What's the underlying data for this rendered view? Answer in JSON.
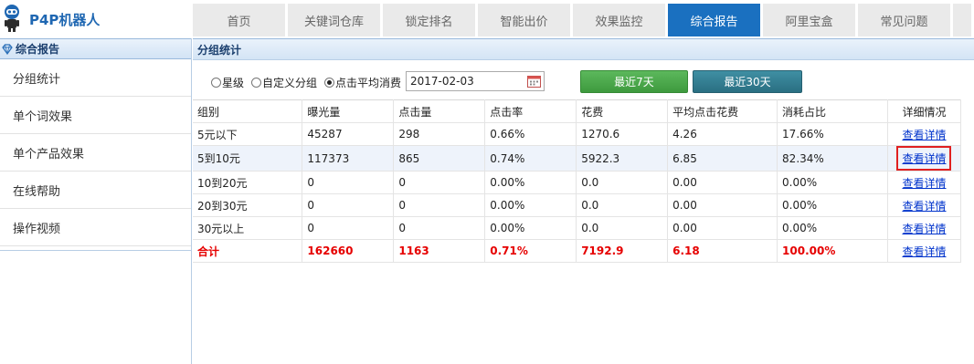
{
  "app": {
    "logo_text": "P4P机器人"
  },
  "nav": {
    "tabs": [
      {
        "label": "首页",
        "active": false
      },
      {
        "label": "关键词仓库",
        "active": false
      },
      {
        "label": "锁定排名",
        "active": false
      },
      {
        "label": "智能出价",
        "active": false
      },
      {
        "label": "效果监控",
        "active": false
      },
      {
        "label": "综合报告",
        "active": true
      },
      {
        "label": "阿里宝盒",
        "active": false
      },
      {
        "label": "常见问题",
        "active": false
      }
    ]
  },
  "sidebar": {
    "title": "综合报告",
    "items": [
      {
        "label": "分组统计"
      },
      {
        "label": "单个词效果"
      },
      {
        "label": "单个产品效果"
      },
      {
        "label": "在线帮助"
      },
      {
        "label": "操作视频"
      }
    ]
  },
  "main": {
    "section_title": "分组统计",
    "filters": {
      "radios": [
        {
          "label": "星级",
          "checked": false
        },
        {
          "label": "自定义分组",
          "checked": false
        },
        {
          "label": "点击平均消费",
          "checked": true
        }
      ],
      "date_value": "2017-02-03",
      "btn_7days": "最近7天",
      "btn_30days": "最近30天"
    },
    "table": {
      "headers": [
        "组别",
        "曝光量",
        "点击量",
        "点击率",
        "花费",
        "平均点击花费",
        "消耗占比",
        "详细情况"
      ],
      "rows": [
        [
          "5元以下",
          "45287",
          "298",
          "0.66%",
          "1270.6",
          "4.26",
          "17.66%",
          "查看详情"
        ],
        [
          "5到10元",
          "117373",
          "865",
          "0.74%",
          "5922.3",
          "6.85",
          "82.34%",
          "查看详情"
        ],
        [
          "10到20元",
          "0",
          "0",
          "0.00%",
          "0.0",
          "0.00",
          "0.00%",
          "查看详情"
        ],
        [
          "20到30元",
          "0",
          "0",
          "0.00%",
          "0.0",
          "0.00",
          "0.00%",
          "查看详情"
        ],
        [
          "30元以上",
          "0",
          "0",
          "0.00%",
          "0.0",
          "0.00",
          "0.00%",
          "查看详情"
        ],
        [
          "合计",
          "162660",
          "1163",
          "0.71%",
          "7192.9",
          "6.18",
          "100.00%",
          "查看详情"
        ]
      ]
    }
  },
  "colors": {
    "nav_active": "#1a70c0",
    "total_row_text": "#e60000",
    "highlight_border": "#e02020"
  }
}
